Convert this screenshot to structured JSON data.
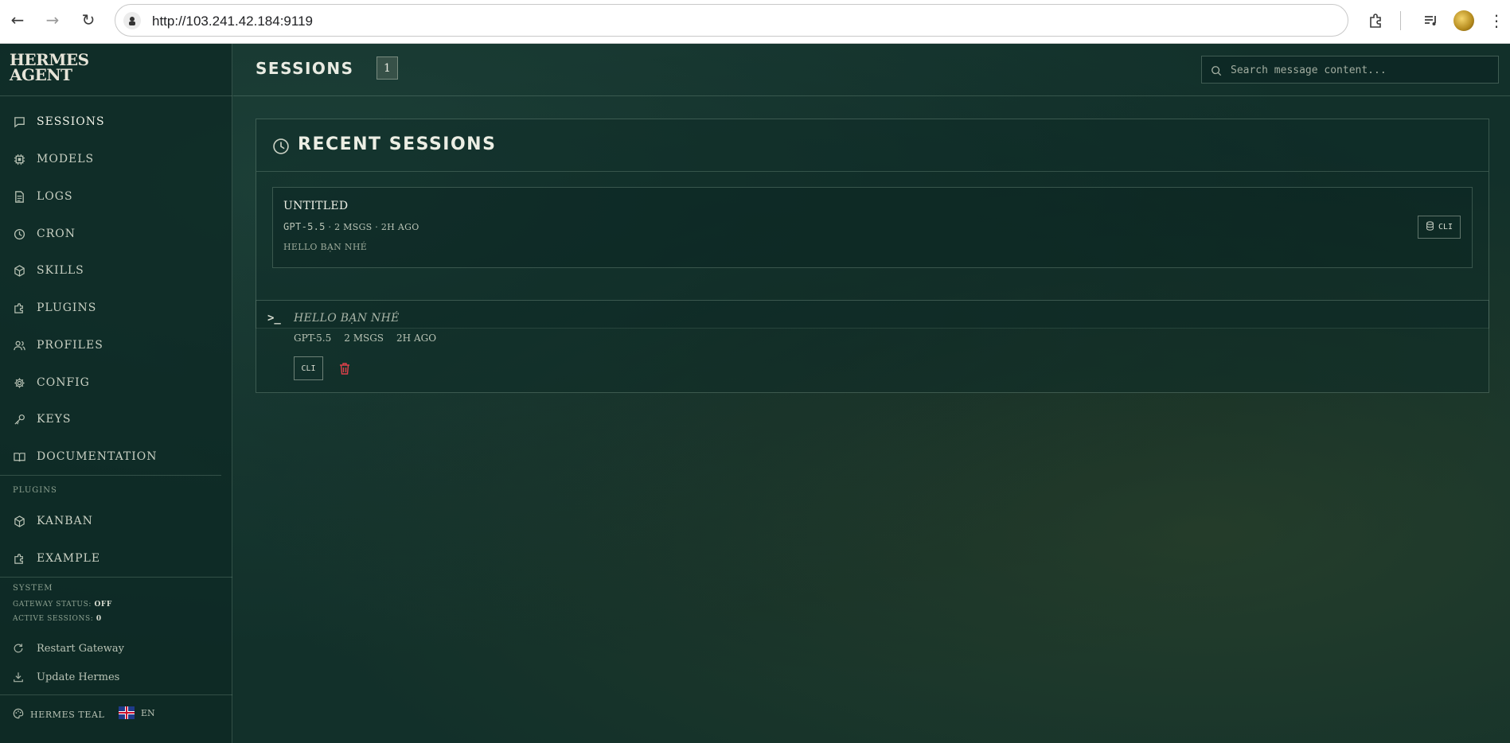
{
  "browser": {
    "url": "http://103.241.42.184:9119"
  },
  "brand": {
    "name": "HERMES\nAGENT"
  },
  "sidebar": {
    "items": [
      {
        "label": "SESSIONS",
        "icon": "chat-icon"
      },
      {
        "label": "MODELS",
        "icon": "chip-icon"
      },
      {
        "label": "LOGS",
        "icon": "file-icon"
      },
      {
        "label": "CRON",
        "icon": "clock-icon"
      },
      {
        "label": "SKILLS",
        "icon": "cube-icon"
      },
      {
        "label": "PLUGINS",
        "icon": "puzzle-icon"
      },
      {
        "label": "PROFILES",
        "icon": "users-icon"
      },
      {
        "label": "CONFIG",
        "icon": "gear-icon"
      },
      {
        "label": "KEYS",
        "icon": "key-icon"
      },
      {
        "label": "DOCUMENTATION",
        "icon": "book-icon"
      }
    ],
    "plugins_label": "PLUGINS",
    "plugin_items": [
      {
        "label": "KANBAN",
        "icon": "cube-icon"
      },
      {
        "label": "EXAMPLE",
        "icon": "puzzle-icon"
      }
    ],
    "system": {
      "label": "SYSTEM",
      "gateway_status_label": "GATEWAY STATUS:",
      "gateway_status_value": "OFF",
      "active_sessions_label": "ACTIVE SESSIONS:",
      "active_sessions_value": "0",
      "restart_label": "Restart Gateway",
      "update_label": "Update Hermes"
    },
    "footer": {
      "theme_label": "HERMES TEAL",
      "language_label": "EN"
    }
  },
  "header": {
    "title": "SESSIONS",
    "count": "1",
    "search_placeholder": "Search message content..."
  },
  "recent": {
    "title": "RECENT SESSIONS",
    "sessions": [
      {
        "name": "UNTITLED",
        "model": "GPT-5.5",
        "meta_rest": "· 2 MSGS · 2H AGO",
        "preview": "HELLO BẠN NHÉ",
        "source": "CLI"
      }
    ]
  },
  "detail": {
    "prompt": ">_",
    "title": "HELLO BẠN NHÉ",
    "model": "GPT-5.5",
    "msgs": "2 MSGS",
    "age": "2H AGO",
    "source": "CLI"
  },
  "colors": {
    "background": "#12302a",
    "delete": "#e0404a"
  }
}
